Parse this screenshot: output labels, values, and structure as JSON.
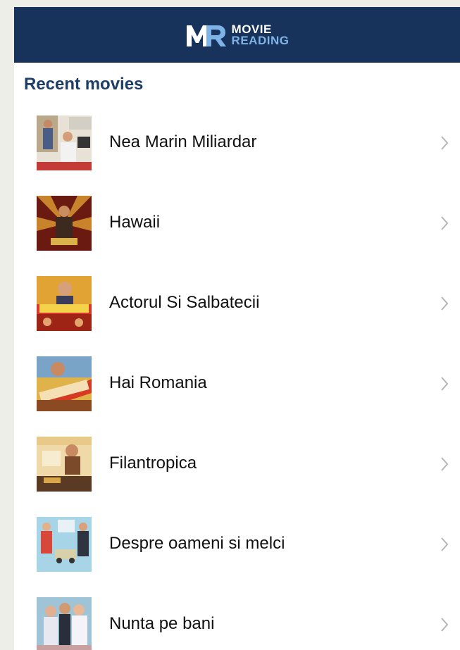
{
  "header": {
    "logo_line1": "MOVIE",
    "logo_line2": "READING",
    "logo_icon": "mr-logo-icon",
    "bg_color": "#17335b"
  },
  "section": {
    "title": "Recent movies"
  },
  "movies": [
    {
      "title": "Nea Marin Miliardar",
      "poster_icon": "poster-nea-marin-miliardar"
    },
    {
      "title": "Hawaii",
      "poster_icon": "poster-hawaii"
    },
    {
      "title": "Actorul Si Salbatecii",
      "poster_icon": "poster-actorul-si-salbatecii"
    },
    {
      "title": "Hai Romania",
      "poster_icon": "poster-hai-romania"
    },
    {
      "title": "Filantropica",
      "poster_icon": "poster-filantropica"
    },
    {
      "title": "Despre oameni si melci",
      "poster_icon": "poster-despre-oameni-si-melci"
    },
    {
      "title": "Nunta pe bani",
      "poster_icon": "poster-nunta-pe-bani"
    }
  ]
}
